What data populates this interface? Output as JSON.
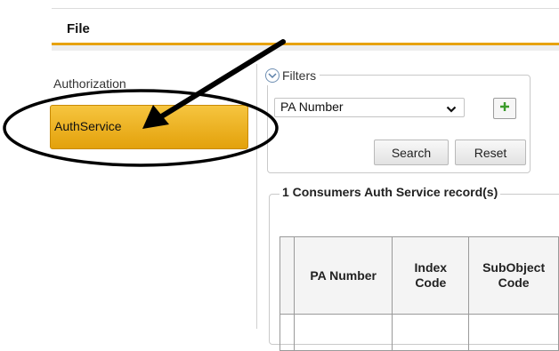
{
  "menubar": {
    "file_label": "File"
  },
  "sidebar": {
    "items": [
      {
        "label": "Authorization"
      },
      {
        "label": "AuthService"
      }
    ]
  },
  "filters": {
    "title": "Filters",
    "selected_field": "PA Number",
    "search_label": "Search",
    "reset_label": "Reset"
  },
  "records": {
    "legend": "1 Consumers Auth Service record(s)",
    "columns": [
      "PA Number",
      "Index Code",
      "SubObject Code"
    ]
  },
  "colors": {
    "accent_gold": "#e7a20e",
    "add_icon_green": "#3a9a2a"
  },
  "icons": [
    "collapse-chevron-icon",
    "dropdown-caret-icon",
    "plus-icon",
    "arrow-annotation",
    "ellipse-annotation"
  ]
}
